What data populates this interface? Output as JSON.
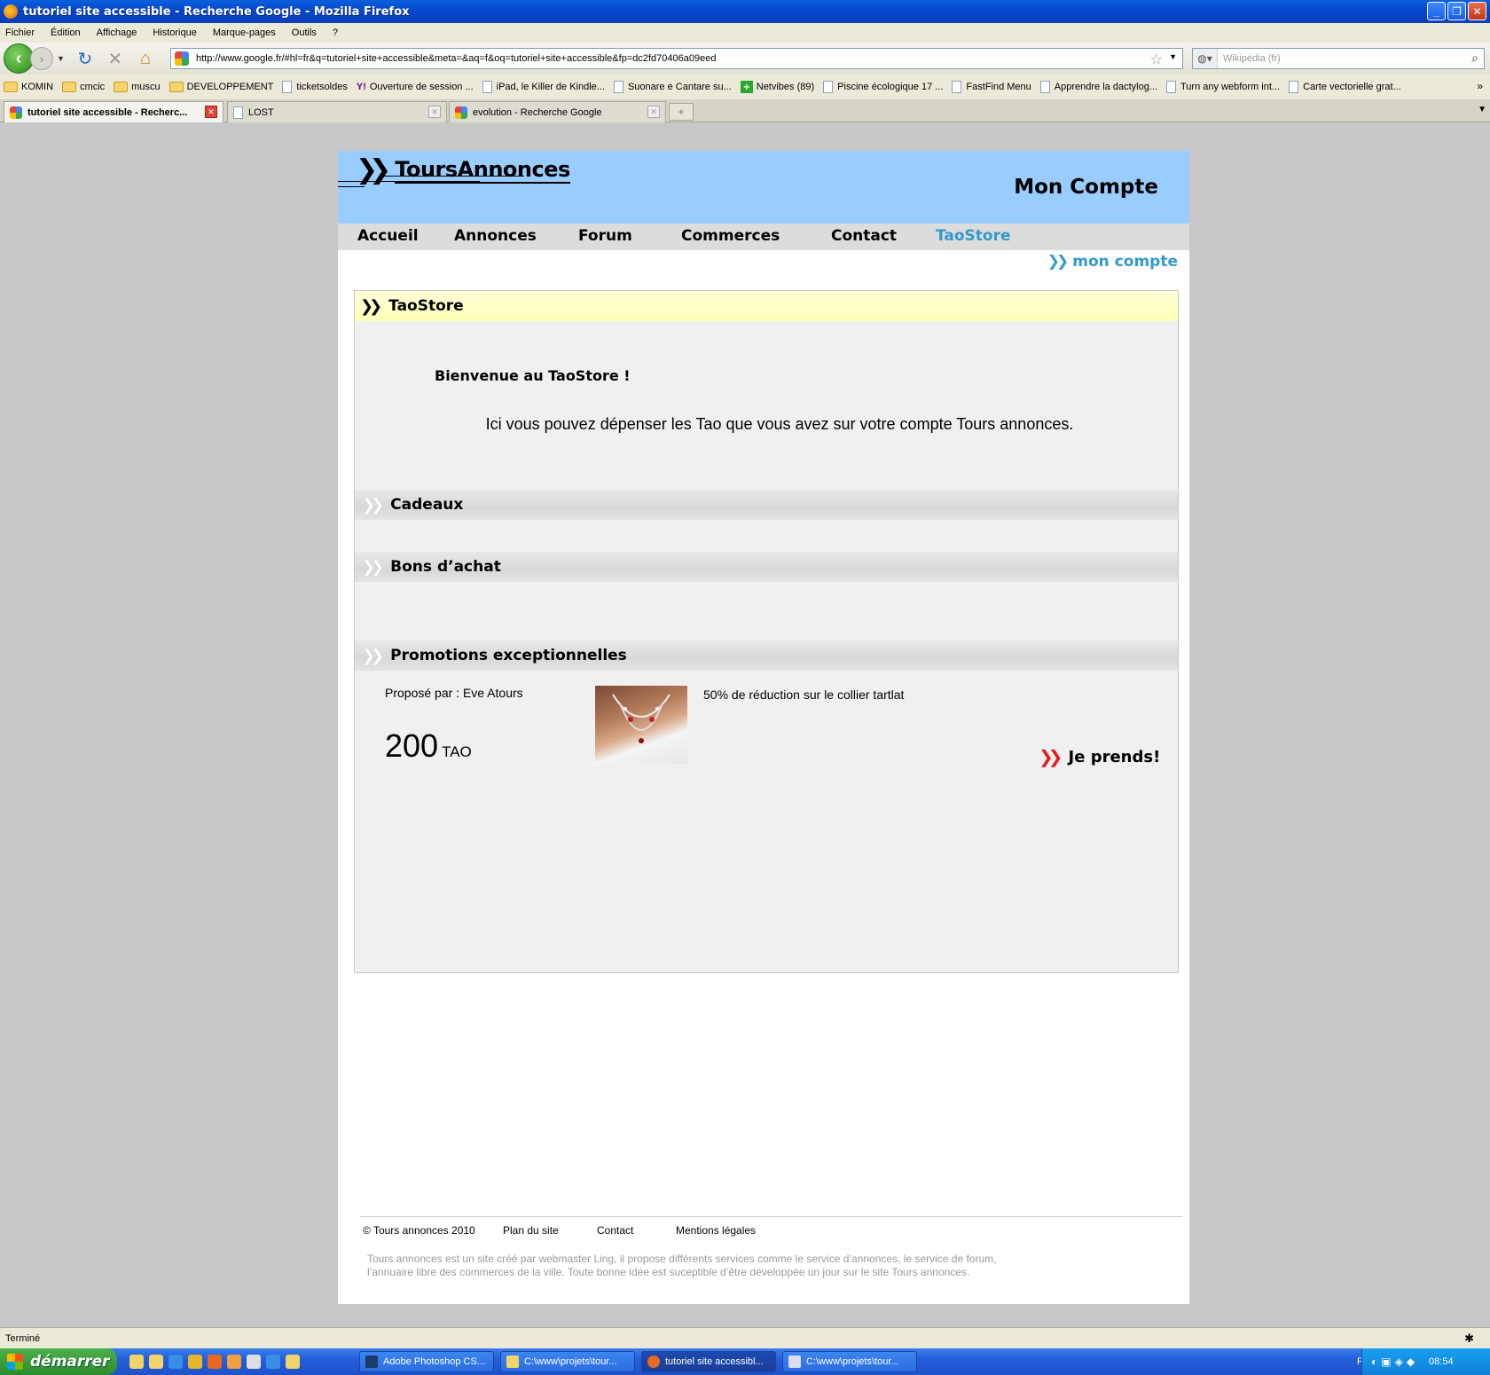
{
  "window": {
    "title": "tutoriel site accessible - Recherche Google - Mozilla Firefox"
  },
  "menu": [
    "Fichier",
    "Édition",
    "Affichage",
    "Historique",
    "Marque-pages",
    "Outils",
    "?"
  ],
  "url": "http://www.google.fr/#hl=fr&q=tutoriel+site+accessible&meta=&aq=f&oq=tutoriel+site+accessible&fp=dc2fd70406a09eed",
  "search_placeholder": "Wikipédia (fr)",
  "bookmarks": [
    {
      "label": "KOMIN",
      "icon": "folder"
    },
    {
      "label": "cmcic",
      "icon": "folder"
    },
    {
      "label": "muscu",
      "icon": "folder"
    },
    {
      "label": "DEVELOPPEMENT",
      "icon": "folder"
    },
    {
      "label": "ticketsoldes",
      "icon": "page"
    },
    {
      "label": "Ouverture de session ...",
      "icon": "yahoo"
    },
    {
      "label": "iPad, le Killer de Kindle...",
      "icon": "page"
    },
    {
      "label": "Suonare e Cantare su...",
      "icon": "page"
    },
    {
      "label": "Netvibes (89)",
      "icon": "plus"
    },
    {
      "label": "Piscine écologique 17 ...",
      "icon": "page"
    },
    {
      "label": "FastFind Menu",
      "icon": "page"
    },
    {
      "label": "Apprendre la dactylog...",
      "icon": "page"
    },
    {
      "label": "Turn any webform int...",
      "icon": "page"
    },
    {
      "label": "Carte vectorielle grat...",
      "icon": "page"
    }
  ],
  "tabs": [
    {
      "label": "tutoriel site accessible - Recherc...",
      "active": true
    },
    {
      "label": "LOST",
      "active": false
    },
    {
      "label": "evolution - Recherche Google",
      "active": false
    }
  ],
  "site": {
    "logo": "ToursAnnonces",
    "header_title": "Mon Compte",
    "nav": [
      "Accueil",
      "Annonces",
      "Forum",
      "Commerces",
      "Contact",
      "TaoStore"
    ],
    "account_link": "mon compte",
    "panel_title": "TaoStore",
    "welcome": "Bienvenue au TaoStore !",
    "intro": "Ici vous pouvez dépenser les Tao que vous avez sur votre compte Tours annonces.",
    "sections": [
      "Cadeaux",
      "Bons d’achat",
      "Promotions exceptionnelles"
    ],
    "promo": {
      "by": "Proposé par : Eve Atours",
      "price": "200",
      "unit": "TAO",
      "description": "50% de réduction sur le collier tartlat",
      "cta": "Je prends!"
    },
    "footer": {
      "links": [
        "© Tours annonces 2010",
        "Plan du site",
        "Contact",
        "Mentions légales"
      ],
      "text": "Tours annonces est un site créé par webmaster Ling, il propose différents services comme le service d’annonces, le service de forum, l’annuaire libre des commerces de la ville. Toute bonne idée est suceptible d’être développée un jour sur le site Tours annonces."
    }
  },
  "status": "Terminé",
  "taskbar": {
    "start": "démarrer",
    "tasks": [
      "Adobe Photoshop CS...",
      "C:\\www\\projets\\tour...",
      "tutoriel site accessibl...",
      "C:\\www\\projets\\tour..."
    ],
    "lang": "FR",
    "clock": "08:54"
  }
}
